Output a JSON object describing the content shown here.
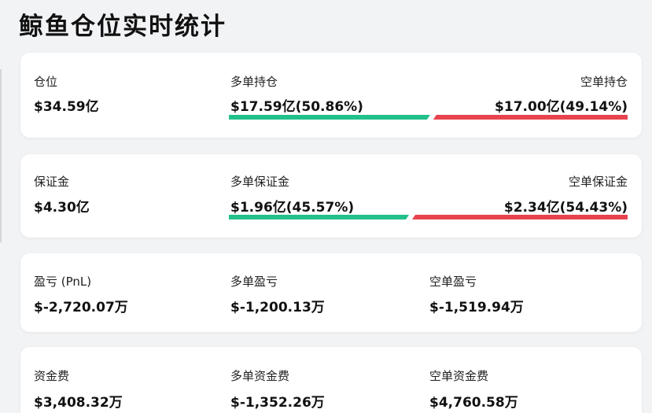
{
  "title": "鲸鱼仓位实时统计",
  "colors": {
    "long": "#22c08a",
    "short": "#e8434f"
  },
  "position": {
    "label": "仓位",
    "value": "$34.59亿",
    "long_label": "多单持仓",
    "long_value": "$17.59亿(50.86%)",
    "short_label": "空单持仓",
    "short_value": "$17.00亿(49.14%)",
    "long_ratio": 0.5086
  },
  "margin": {
    "label": "保证金",
    "value": "$4.30亿",
    "long_label": "多单保证金",
    "long_value": "$1.96亿(45.57%)",
    "short_label": "空单保证金",
    "short_value": "$2.34亿(54.43%)",
    "long_ratio": 0.4557
  },
  "pnl": {
    "label": "盈亏 (PnL)",
    "value": "$-2,720.07万",
    "long_label": "多单盈亏",
    "long_value": "$-1,200.13万",
    "short_label": "空单盈亏",
    "short_value": "$-1,519.94万"
  },
  "funding": {
    "label": "资金费",
    "value": "$3,408.32万",
    "long_label": "多单资金费",
    "long_value": "$-1,352.26万",
    "short_label": "空单资金费",
    "short_value": "$4,760.58万"
  }
}
